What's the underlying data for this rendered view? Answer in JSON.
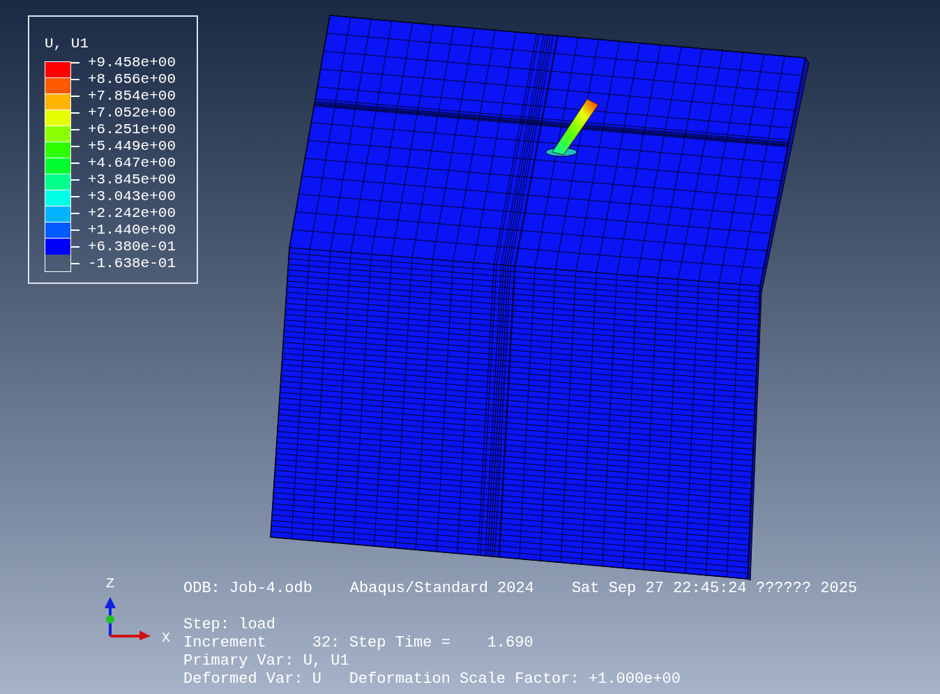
{
  "legend": {
    "title": "U, U1",
    "bands": [
      {
        "color": "#ff0000"
      },
      {
        "color": "#ff5a00"
      },
      {
        "color": "#ffb400"
      },
      {
        "color": "#e6ff00"
      },
      {
        "color": "#8cff00"
      },
      {
        "color": "#2eff00"
      },
      {
        "color": "#00ff2e"
      },
      {
        "color": "#00ff8c"
      },
      {
        "color": "#00ffe6"
      },
      {
        "color": "#00b4ff"
      },
      {
        "color": "#005aff"
      },
      {
        "color": "#0000ff"
      }
    ],
    "labels": [
      "+9.458e+00",
      "+8.656e+00",
      "+7.854e+00",
      "+7.052e+00",
      "+6.251e+00",
      "+5.449e+00",
      "+4.647e+00",
      "+3.845e+00",
      "+3.043e+00",
      "+2.242e+00",
      "+1.440e+00",
      "+6.380e-01",
      "-1.638e-01"
    ]
  },
  "triad": {
    "z_label": "Z",
    "x_label": "X"
  },
  "header": [
    "ODB: Job-4.odb",
    "Abaqus/Standard 2024",
    "Sat Sep 27 22:45:24 ?????? 2025"
  ],
  "info": [
    "Step: load",
    "Increment     32: Step Time =    1.690",
    "Primary Var: U, U1",
    "Deformed Var: U   Deformation Scale Factor: +1.000e+00"
  ]
}
